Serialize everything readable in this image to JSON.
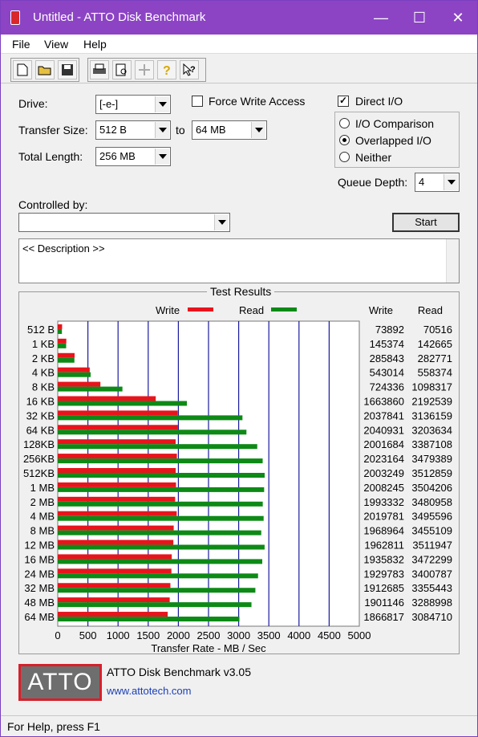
{
  "window": {
    "title": "Untitled - ATTO Disk Benchmark",
    "minimize": "—",
    "maximize": "☐",
    "close": "✕"
  },
  "menu": [
    "File",
    "View",
    "Help"
  ],
  "form": {
    "drive_label": "Drive:",
    "drive_value": "[-e-]",
    "transfer_size_label": "Transfer Size:",
    "transfer_from": "512 B",
    "to_label": "to",
    "transfer_to": "64 MB",
    "total_length_label": "Total Length:",
    "total_length_value": "256 MB",
    "force_write_label": "Force Write Access",
    "force_write_checked": false,
    "direct_io_label": "Direct I/O",
    "direct_io_checked": true,
    "io_comparison_label": "I/O Comparison",
    "overlapped_io_label": "Overlapped I/O",
    "neither_label": "Neither",
    "selected_mode": "Overlapped I/O",
    "queue_depth_label": "Queue Depth:",
    "queue_depth_value": "4",
    "controlled_by_label": "Controlled by:",
    "controlled_by_value": "",
    "start_label": "Start",
    "description": "<< Description >>"
  },
  "results": {
    "title": "Test Results",
    "col_write": "Write",
    "col_read": "Read"
  },
  "chart_data": {
    "type": "bar",
    "orientation": "horizontal",
    "xlabel": "Transfer Rate - MB / Sec",
    "xlim": [
      0,
      5000
    ],
    "x_ticks": [
      "0",
      "500",
      "1000",
      "1500",
      "2000",
      "2500",
      "3000",
      "3500",
      "4000",
      "4500",
      "5000"
    ],
    "grid": true,
    "legend": "top",
    "categories": [
      "512 B",
      "1 KB",
      "2 KB",
      "4 KB",
      "8 KB",
      "16 KB",
      "32 KB",
      "64 KB",
      "128KB",
      "256KB",
      "512KB",
      "1 MB",
      "2 MB",
      "4 MB",
      "8 MB",
      "12 MB",
      "16 MB",
      "24 MB",
      "32 MB",
      "48 MB",
      "64 MB"
    ],
    "series": [
      {
        "name": "Write",
        "color": "#e8141c",
        "values": [
          73892,
          145374,
          285843,
          543014,
          724336,
          1663860,
          2037841,
          2040931,
          2001684,
          2023164,
          2003249,
          2008245,
          1993332,
          2019781,
          1968964,
          1962811,
          1935832,
          1929783,
          1912685,
          1901146,
          1866817
        ]
      },
      {
        "name": "Read",
        "color": "#0d8a16",
        "values": [
          70516,
          142665,
          282771,
          558374,
          1098317,
          2192539,
          3136159,
          3203634,
          3387108,
          3479389,
          3512859,
          3504206,
          3480958,
          3495596,
          3455109,
          3511947,
          3472299,
          3400787,
          3355443,
          3288998,
          3084710
        ]
      }
    ]
  },
  "brand": {
    "logo": "ATTO",
    "title": "ATTO Disk Benchmark v3.05",
    "url": "www.attotech.com"
  },
  "status": "For Help, press F1"
}
